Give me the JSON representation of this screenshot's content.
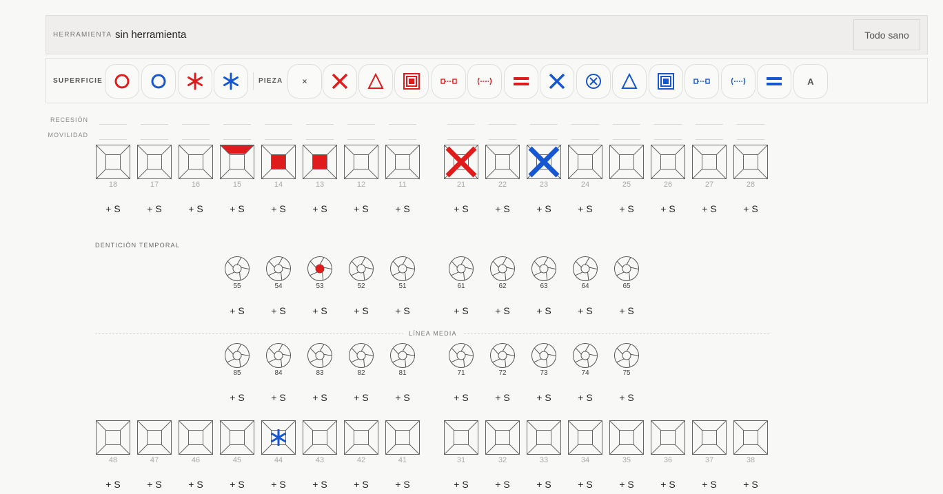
{
  "toolbar": {
    "label": "HERRAMIENTA",
    "value": "sin herramienta",
    "reset_button": "Todo sano"
  },
  "palette": {
    "surface_label": "SUPERFICIE",
    "piece_label": "PIEZA",
    "letter_tool": "A",
    "surface_tools": [
      "red-circle-icon",
      "blue-circle-icon",
      "red-asterisk-icon",
      "blue-asterisk-icon"
    ],
    "piece_tools": [
      "small-x-icon",
      "red-x-icon",
      "red-triangle-icon",
      "red-square-icon",
      "red-bridge-icon",
      "red-bracket-bridge-icon",
      "red-equals-icon",
      "blue-x-icon",
      "blue-circled-x-icon",
      "blue-triangle-icon",
      "blue-square-icon",
      "blue-bridge-icon",
      "blue-bracket-bridge-icon",
      "blue-equals-icon",
      "letter-a-icon"
    ],
    "colors": {
      "red": "#e01b1b",
      "blue": "#1656d0"
    }
  },
  "rows": {
    "recesion": "RECESIÓN",
    "movilidad": "MOVILIDAD"
  },
  "plus_label": "+ S",
  "upper_permanent": [
    "18",
    "17",
    "16",
    "15",
    "14",
    "13",
    "12",
    "11",
    "21",
    "22",
    "23",
    "24",
    "25",
    "26",
    "27",
    "28"
  ],
  "lower_permanent": [
    "48",
    "47",
    "46",
    "45",
    "44",
    "43",
    "42",
    "41",
    "31",
    "32",
    "33",
    "34",
    "35",
    "36",
    "37",
    "38"
  ],
  "temporal_label": "DENTICIÓN TEMPORAL",
  "upper_temporal": [
    "55",
    "54",
    "53",
    "52",
    "51",
    "61",
    "62",
    "63",
    "64",
    "65"
  ],
  "lower_temporal": [
    "85",
    "84",
    "83",
    "82",
    "81",
    "71",
    "72",
    "73",
    "74",
    "75"
  ],
  "midline_label": "LÍNEA MEDIA",
  "marks": {
    "15": "top-red",
    "14": "center-red",
    "13": "center-red",
    "21": "red-x",
    "23": "blue-x",
    "44": "blue-asterisk",
    "53": "center-red-dot"
  }
}
